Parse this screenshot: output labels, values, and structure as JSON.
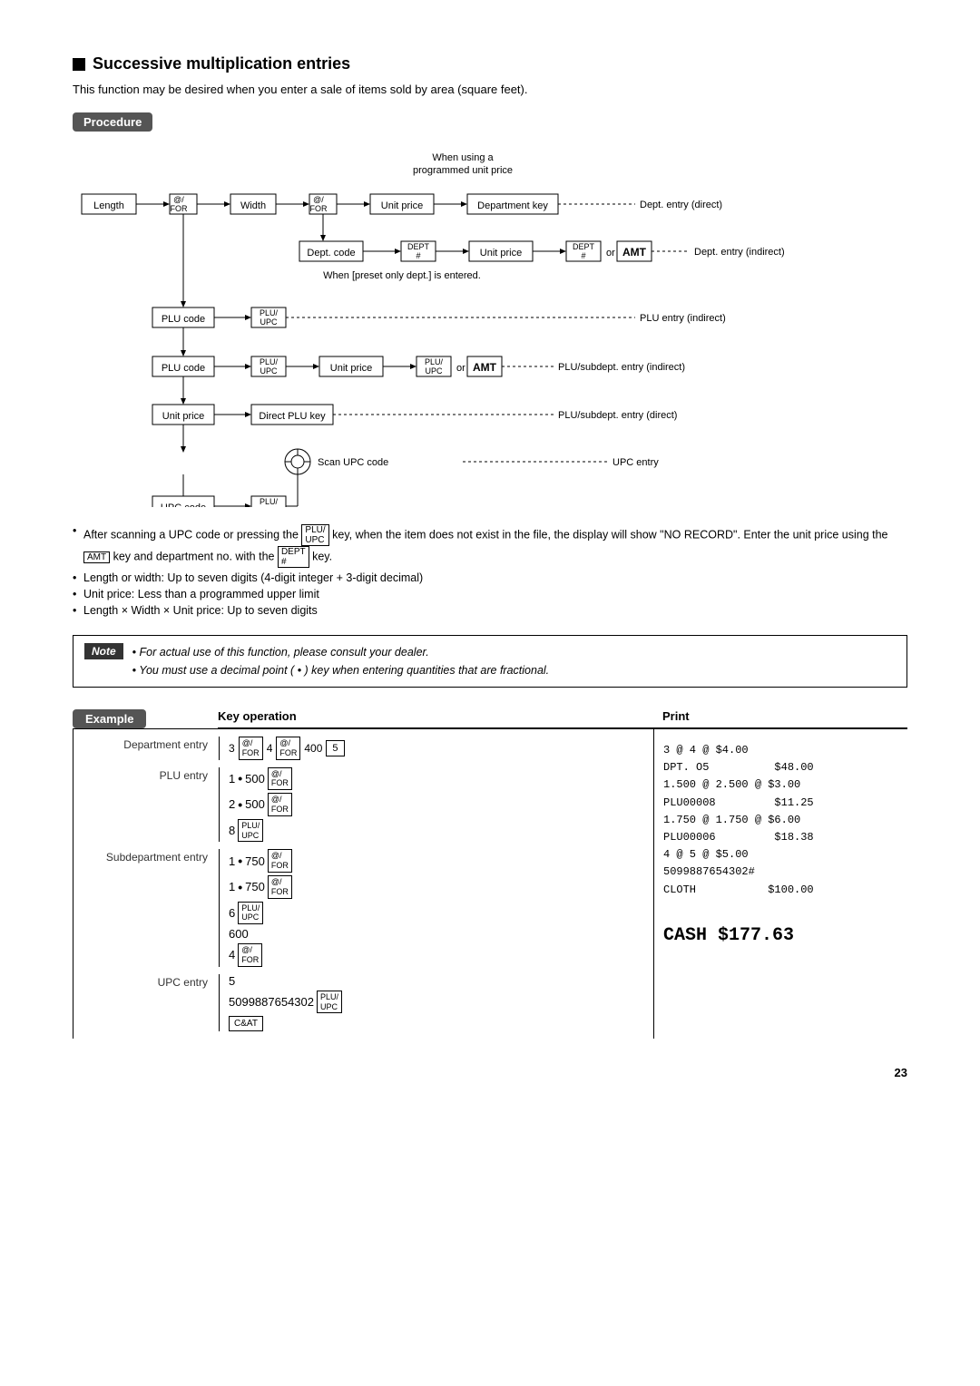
{
  "page": {
    "title": "Successive multiplication entries",
    "subtitle": "This function may be desired when you enter a sale of items sold by area (square feet).",
    "procedure_badge": "Procedure",
    "example_badge": "Example",
    "note_badge": "Note",
    "page_number": "23"
  },
  "notes": [
    "After scanning a UPC code or pressing the PLU/UPC key, when the item does not exist in the file, the display will show \"NO RECORD\". Enter the unit price using the AMT key and department no. with the DEPT # key.",
    "Length or width: Up to seven digits (4-digit integer + 3-digit decimal)",
    "Unit price: Less than a programmed upper limit",
    "Length × Width × Unit price: Up to seven digits"
  ],
  "note_items": [
    "For actual use of this function, please consult your dealer.",
    "You must use a decimal point ( • ) key when entering quantities that are fractional."
  ],
  "example": {
    "key_operation_header": "Key operation",
    "print_header": "Print",
    "entries": [
      {
        "label": "Department entry",
        "keys": [
          {
            "value": "3",
            "type": "num"
          },
          {
            "value": "@/\nFOR",
            "type": "btn"
          },
          {
            "value": "4",
            "type": "num"
          },
          {
            "value": "@/\nFOR",
            "type": "btn"
          },
          {
            "value": "400",
            "type": "num"
          },
          {
            "value": "5",
            "type": "btn"
          }
        ]
      },
      {
        "label": "PLU entry",
        "keys": [
          {
            "value": "1",
            "type": "num"
          },
          {
            "value": "•",
            "type": "dot"
          },
          {
            "value": "500",
            "type": "num"
          },
          {
            "value": "@/\nFOR",
            "type": "btn"
          },
          {
            "value": "2",
            "type": "num"
          },
          {
            "value": "•",
            "type": "dot"
          },
          {
            "value": "500",
            "type": "num"
          },
          {
            "value": "@/\nFOR",
            "type": "btn"
          },
          {
            "value": "8",
            "type": "num"
          },
          {
            "value": "PLU/\nUPC",
            "type": "btn"
          }
        ]
      },
      {
        "label": "Subdepartment entry",
        "keys": [
          {
            "value": "1",
            "type": "num"
          },
          {
            "value": "•",
            "type": "dot"
          },
          {
            "value": "750",
            "type": "num"
          },
          {
            "value": "@/\nFOR",
            "type": "btn"
          },
          {
            "value": "1",
            "type": "num"
          },
          {
            "value": "•",
            "type": "dot"
          },
          {
            "value": "750",
            "type": "num"
          },
          {
            "value": "@/\nFOR",
            "type": "btn"
          },
          {
            "value": "6",
            "type": "num"
          },
          {
            "value": "PLU/\nUPC",
            "type": "btn"
          },
          {
            "value": "600",
            "type": "num"
          },
          {
            "value": "4",
            "type": "num"
          },
          {
            "value": "@/\nFOR",
            "type": "btn"
          }
        ]
      },
      {
        "label": "UPC entry",
        "keys": [
          {
            "value": "5",
            "type": "num"
          },
          {
            "value": "5099887654302",
            "type": "num"
          },
          {
            "value": "PLU/\nUPC",
            "type": "btn"
          },
          {
            "value": "C&AT",
            "type": "btn"
          }
        ]
      }
    ],
    "print_lines": [
      "3 @ 4 @ $4.00",
      "DPT. O5          $48.00",
      "1.500 @ 2.500 @ $3.00",
      "PLU00008         $11.25",
      "1.750 @ 1.750 @ $6.00",
      "PLU00006         $18.38",
      "4 @ 5 @ $5.00",
      "5099887654302#",
      "CLOTH           $100.00",
      "",
      "CASH    $177.63"
    ]
  }
}
